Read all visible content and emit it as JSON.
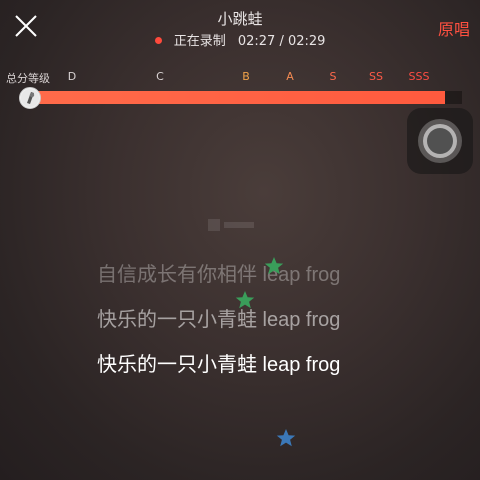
{
  "header": {
    "song_title": "小跳蛙",
    "recording_status": "正在录制",
    "time_current": "02:27",
    "time_separator": "/",
    "time_total": "02:29",
    "original_vocal_label": "原唱",
    "close_icon": "close-icon"
  },
  "score": {
    "label": "总分等级",
    "grades": [
      {
        "text": "D",
        "color": "#d9d3d3"
      },
      {
        "text": "C",
        "color": "#d9d3d3"
      },
      {
        "text": "B",
        "color": "#f0a24a"
      },
      {
        "text": "A",
        "color": "#f48a52"
      },
      {
        "text": "S",
        "color": "#ff6a4c"
      },
      {
        "text": "SS",
        "color": "#ff5a48"
      },
      {
        "text": "SSS",
        "color": "#ff4d44"
      }
    ],
    "progress_fraction": 0.96,
    "bar_color": "#ff5f44"
  },
  "lyrics": [
    {
      "text": "自信成长有你相伴 leap frog"
    },
    {
      "text": "快乐的一只小青蛙 leap frog"
    },
    {
      "text": "快乐的一只小青蛙 leap frog"
    }
  ],
  "decorations": {
    "stars": [
      {
        "icon": "star-icon",
        "color": "#3a9d5a"
      },
      {
        "icon": "star-icon",
        "color": "#3a9d5a"
      },
      {
        "icon": "star-icon",
        "color": "#3b78b8"
      }
    ]
  },
  "assistive_touch_icon": "assistive-touch-icon"
}
